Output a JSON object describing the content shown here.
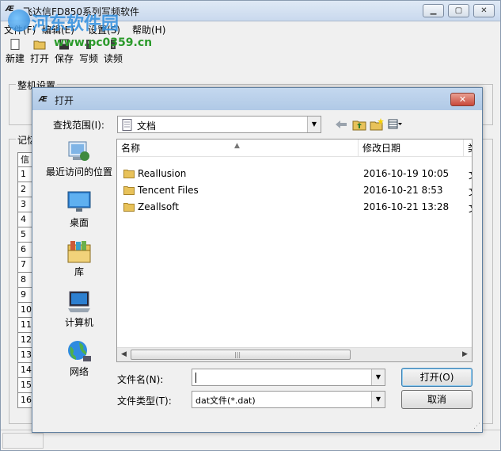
{
  "main_window": {
    "title": "飞达信FD850系列写频软件",
    "min_symbol": "▁",
    "max_symbol": "▢",
    "close_symbol": "✕",
    "menu": [
      "文件(F)",
      "编辑(E)",
      "设置(S)",
      "帮助(H)"
    ],
    "toolbar": [
      {
        "label": "新建",
        "icon": "new-file-icon"
      },
      {
        "label": "打开",
        "icon": "open-folder-icon"
      },
      {
        "label": "保存",
        "icon": "save-disk-icon"
      },
      {
        "label": "写频",
        "icon": "write-radio-icon"
      },
      {
        "label": "读频",
        "icon": "read-radio-icon"
      }
    ],
    "group_machine": "整机设置",
    "group_memory": "记忆",
    "memory_header": "信",
    "memory_rows": [
      "1",
      "2",
      "3",
      "4",
      "5",
      "6",
      "7",
      "8",
      "9",
      "10",
      "11",
      "12",
      "13",
      "14",
      "15",
      "16"
    ]
  },
  "watermark": {
    "text": "河东软件园",
    "url": "www.pc0359.cn"
  },
  "dialog": {
    "title": "打开",
    "close_symbol": "✕",
    "look_in_label": "查找范围(I):",
    "look_in_value": "文档",
    "places": [
      {
        "label": "最近访问的位置",
        "icon": "recent-places-icon"
      },
      {
        "label": "桌面",
        "icon": "desktop-icon"
      },
      {
        "label": "库",
        "icon": "libraries-icon"
      },
      {
        "label": "计算机",
        "icon": "computer-icon"
      },
      {
        "label": "网络",
        "icon": "network-icon"
      }
    ],
    "columns": {
      "name": "名称",
      "date": "修改日期",
      "extra": "类"
    },
    "files": [
      {
        "name": "Reallusion",
        "date": "2016-10-19 10:05",
        "extra": "文"
      },
      {
        "name": "Tencent Files",
        "date": "2016-10-21 8:53",
        "extra": "文"
      },
      {
        "name": "Zeallsoft",
        "date": "2016-10-21 13:28",
        "extra": "文"
      }
    ],
    "filename_label": "文件名(N):",
    "filename_value": "",
    "filetype_label": "文件类型(T):",
    "filetype_value": "dat文件(*.dat)",
    "open_button": "打开(O)",
    "cancel_button": "取消"
  },
  "colors": {
    "titlebar": "#c9d9ee",
    "dialog_close": "#c8483a",
    "folder": "#e8c25a",
    "accent": "#3c7fb1"
  }
}
